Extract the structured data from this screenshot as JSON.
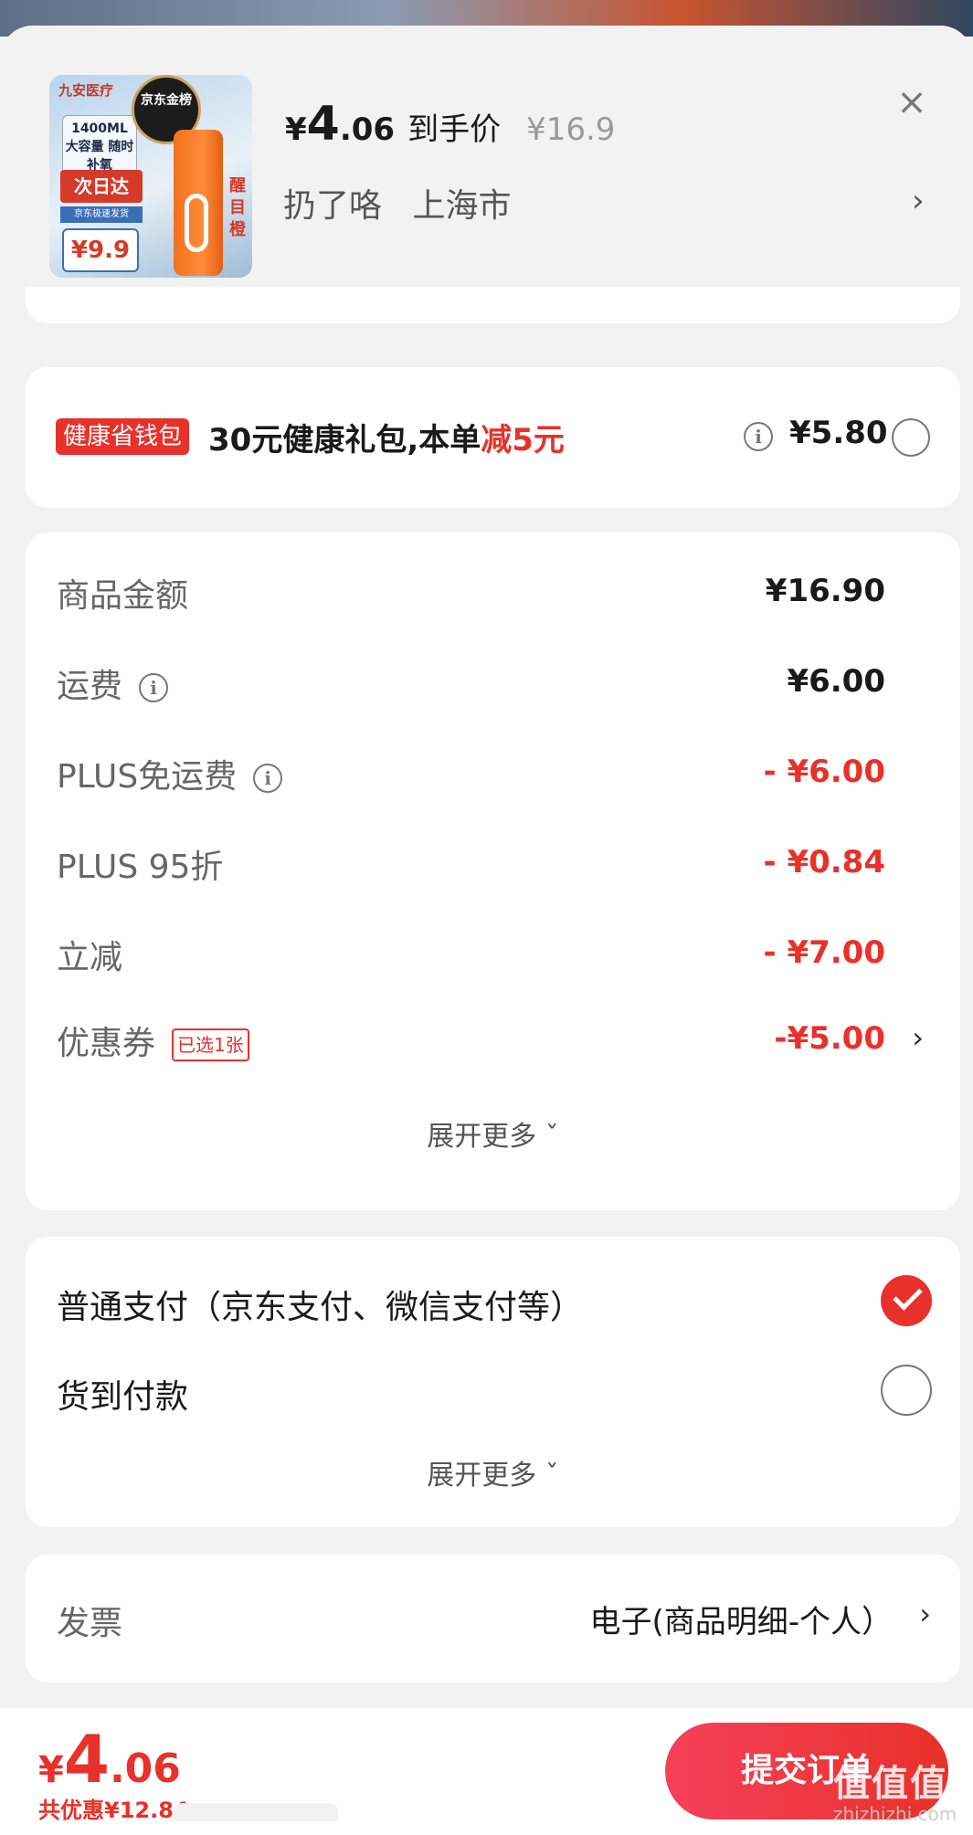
{
  "product": {
    "thumb": {
      "brand": "九安医疗",
      "capacity": "1400ML 大容量 随时补氧",
      "next_day": "次日达",
      "delivery": "京东极速发货",
      "price": "¥9.9",
      "medal": "京东金榜",
      "side_text": "醒目橙"
    },
    "price_symbol": "¥",
    "price_int": "4",
    "price_dec": ".06",
    "price_label": "到手价",
    "original_price": "¥16.9",
    "address_name": "扔了咯",
    "address_city": "上海市",
    "close_glyph": "×",
    "arrow_glyph": "›"
  },
  "gift": {
    "tag": "健康省钱包",
    "text_main": "30元健康礼包,本单",
    "text_red": "减5元",
    "price": "¥5.80",
    "selected": false
  },
  "fees": {
    "rows": [
      {
        "label": "商品金额",
        "value": "¥16.90",
        "red": false,
        "info": false
      },
      {
        "label": "运费",
        "value": "¥6.00",
        "red": false,
        "info": true
      },
      {
        "label": "PLUS免运费",
        "value": "- ¥6.00",
        "red": true,
        "info": true
      },
      {
        "label": "PLUS 95折",
        "value": "- ¥0.84",
        "red": true,
        "info": false
      },
      {
        "label": "立减",
        "value": "- ¥7.00",
        "red": true,
        "info": false
      }
    ],
    "coupon_label": "优惠券",
    "coupon_tag": "已选1张",
    "coupon_value": "-¥5.00",
    "expand_label": "展开更多 ˇ"
  },
  "payment": {
    "options": [
      {
        "label": "普通支付（京东支付、微信支付等）",
        "selected": true
      },
      {
        "label": "货到付款",
        "selected": false
      }
    ],
    "expand_label": "展开更多 ˇ"
  },
  "invoice": {
    "label": "发票",
    "value": "电子(商品明细-个人）"
  },
  "footer": {
    "total_symbol": "¥",
    "total_int": "4",
    "total_dec": ".06",
    "saved": "共优惠¥12.84",
    "submit_label": "提交订单"
  },
  "watermark": {
    "text": "值值值",
    "sub": "zhizhizhi.com"
  },
  "colors": {
    "accent_red": "#e8312a",
    "background": "#f2f2f2"
  }
}
